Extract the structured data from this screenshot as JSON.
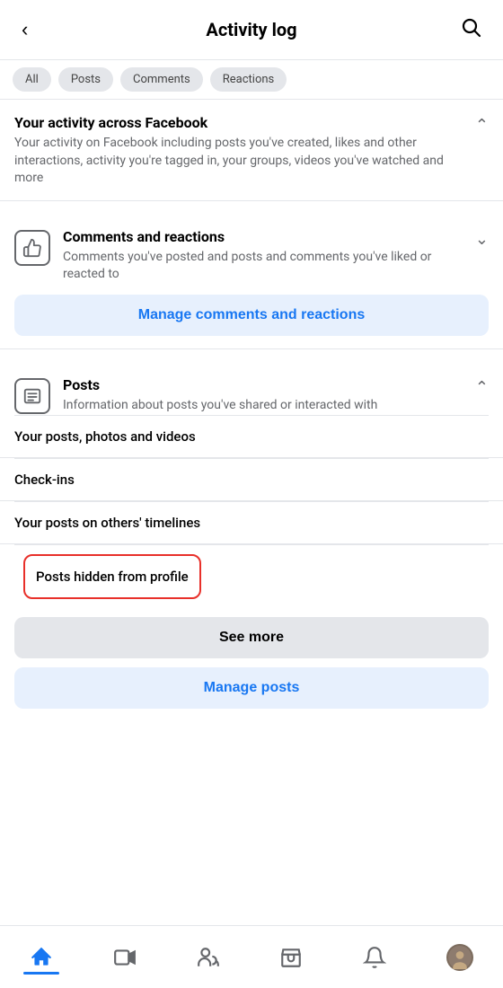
{
  "header": {
    "title": "Activity log",
    "back_label": "‹",
    "search_label": "🔍"
  },
  "tabs": {
    "items": [
      "All",
      "Posts",
      "Comments",
      "Reactions"
    ]
  },
  "activity_section": {
    "title": "Your activity across Facebook",
    "description": "Your activity on Facebook including posts you've created, likes and other interactions, activity you're tagged in, your groups, videos you've watched and more",
    "expanded": true
  },
  "comments_section": {
    "icon": "thumbs-up",
    "title": "Comments and reactions",
    "description": "Comments you've posted and posts and comments you've liked or reacted to",
    "expanded": false,
    "manage_label": "Manage comments and reactions"
  },
  "posts_section": {
    "icon": "posts",
    "title": "Posts",
    "description": "Information about posts you've shared or interacted with",
    "expanded": true,
    "sub_items": [
      {
        "label": "Your posts, photos and videos"
      },
      {
        "label": "Check-ins"
      },
      {
        "label": "Your posts on others' timelines"
      },
      {
        "label": "Posts hidden from profile",
        "highlighted": true
      }
    ],
    "see_more_label": "See more",
    "manage_label": "Manage posts"
  },
  "bottom_nav": {
    "items": [
      {
        "name": "home",
        "label": "Home",
        "active": true
      },
      {
        "name": "video",
        "label": "Video",
        "active": false
      },
      {
        "name": "friends",
        "label": "Friends",
        "active": false
      },
      {
        "name": "marketplace",
        "label": "Marketplace",
        "active": false
      },
      {
        "name": "notifications",
        "label": "Notifications",
        "active": false
      },
      {
        "name": "profile",
        "label": "Profile",
        "active": false
      }
    ]
  }
}
